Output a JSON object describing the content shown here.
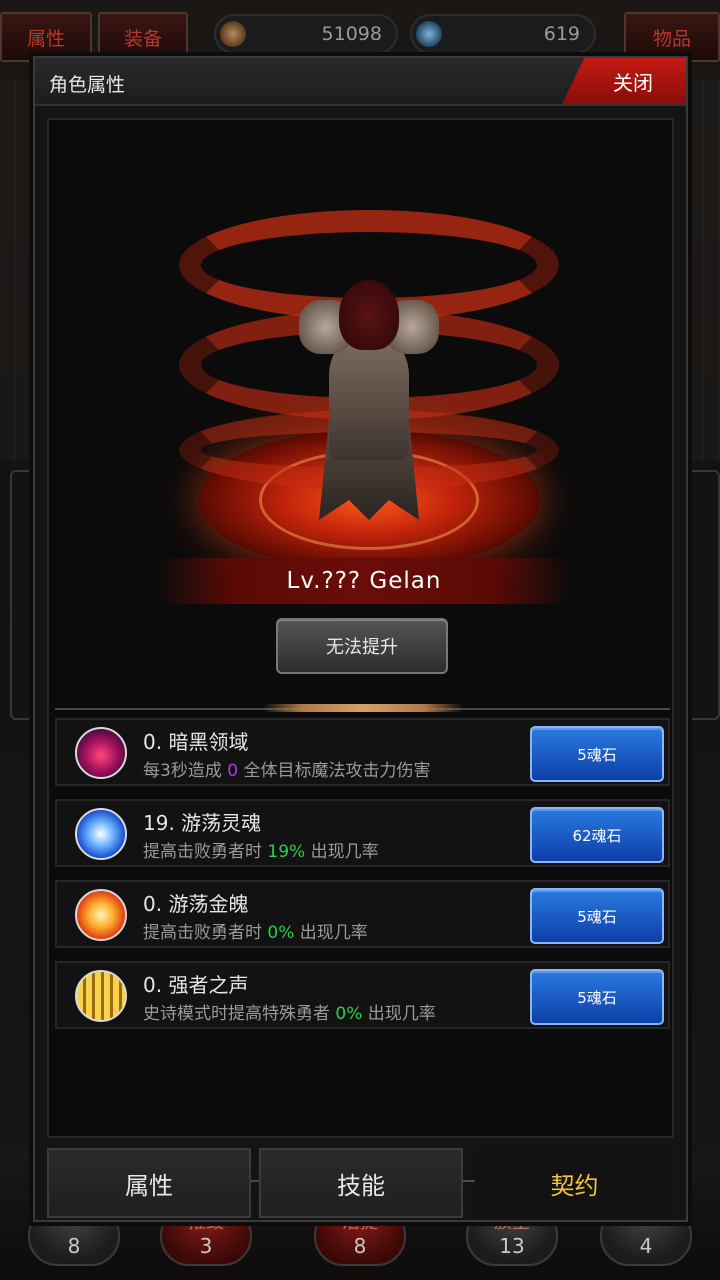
{
  "background": {
    "top_tabs": [
      "属性",
      "装备",
      "物品"
    ],
    "currency": [
      {
        "icon": "gold-coin-icon",
        "value": "51098"
      },
      {
        "icon": "soul-orb-icon",
        "value": "619"
      }
    ],
    "bottom_circles": [
      {
        "label": "",
        "value": "8"
      },
      {
        "label": "摧毁",
        "value": "3"
      },
      {
        "label": "活捉",
        "value": "8"
      },
      {
        "label": "族室",
        "value": "13"
      },
      {
        "label": "",
        "value": "4"
      }
    ]
  },
  "dialog": {
    "title": "角色属性",
    "close_label": "关闭",
    "character": {
      "name_label": "Lv.??? Gelan",
      "upgrade_label": "无法提升"
    },
    "skills": [
      {
        "name": "0. 暗黑领域",
        "desc_pre": "每3秒造成 ",
        "desc_value": "0",
        "desc_post": " 全体目标魔法攻击力伤害",
        "value_color": "#b038d6",
        "icon": "dark-domain-icon",
        "cost": "5魂石"
      },
      {
        "name": "19. 游荡灵魂",
        "desc_pre": "提高击败勇者时 ",
        "desc_value": "19%",
        "desc_post": " 出现几率",
        "value_color": "#2bd04a",
        "icon": "wandering-soul-icon",
        "cost": "62魂石"
      },
      {
        "name": "0. 游荡金魄",
        "desc_pre": "提高击败勇者时 ",
        "desc_value": "0%",
        "desc_post": " 出现几率",
        "value_color": "#2bd04a",
        "icon": "golden-soul-icon",
        "cost": "5魂石"
      },
      {
        "name": "0. 强者之声",
        "desc_pre": "史诗模式时提高特殊勇者 ",
        "desc_value": "0%",
        "desc_post": " 出现几率",
        "value_color": "#2bd04a",
        "icon": "voice-of-strength-icon",
        "cost": "5魂石"
      }
    ],
    "tabs": [
      {
        "label": "属性",
        "active": false
      },
      {
        "label": "技能",
        "active": false
      },
      {
        "label": "契约",
        "active": true
      }
    ],
    "colors": {
      "accent_red": "#c51a14",
      "active_tab": "#f1c33a",
      "button_blue": "#2a7ae0"
    }
  }
}
